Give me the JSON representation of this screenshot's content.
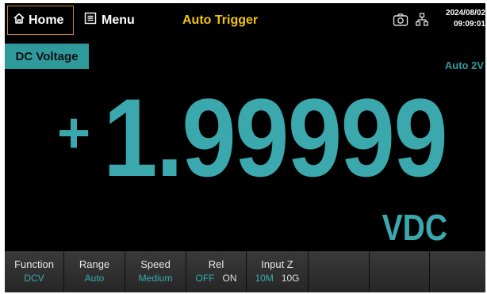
{
  "header": {
    "home_label": "Home",
    "menu_label": "Menu",
    "trigger_label": "Auto Trigger",
    "date": "2024/08/02",
    "time": "09:09:01"
  },
  "display": {
    "mode_label": "DC Voltage",
    "range_indicator": "Auto 2V",
    "sign": "+",
    "reading": "1.99999",
    "unit": "VDC"
  },
  "softkeys": {
    "function": {
      "title": "Function",
      "value": "DCV"
    },
    "range": {
      "title": "Range",
      "value": "Auto"
    },
    "speed": {
      "title": "Speed",
      "value": "Medium"
    },
    "rel": {
      "title": "Rel",
      "option_1": "OFF",
      "option_2": "ON",
      "selected": "OFF"
    },
    "input_z": {
      "title": "Input Z",
      "option_1": "10M",
      "option_2": "10G",
      "selected": "10M"
    }
  },
  "colors": {
    "accent": "#36aeb3",
    "trigger": "#f2c40e",
    "home_border": "#c48a2a"
  },
  "icons": [
    "home-icon",
    "menu-icon",
    "camera-icon",
    "network-icon"
  ]
}
